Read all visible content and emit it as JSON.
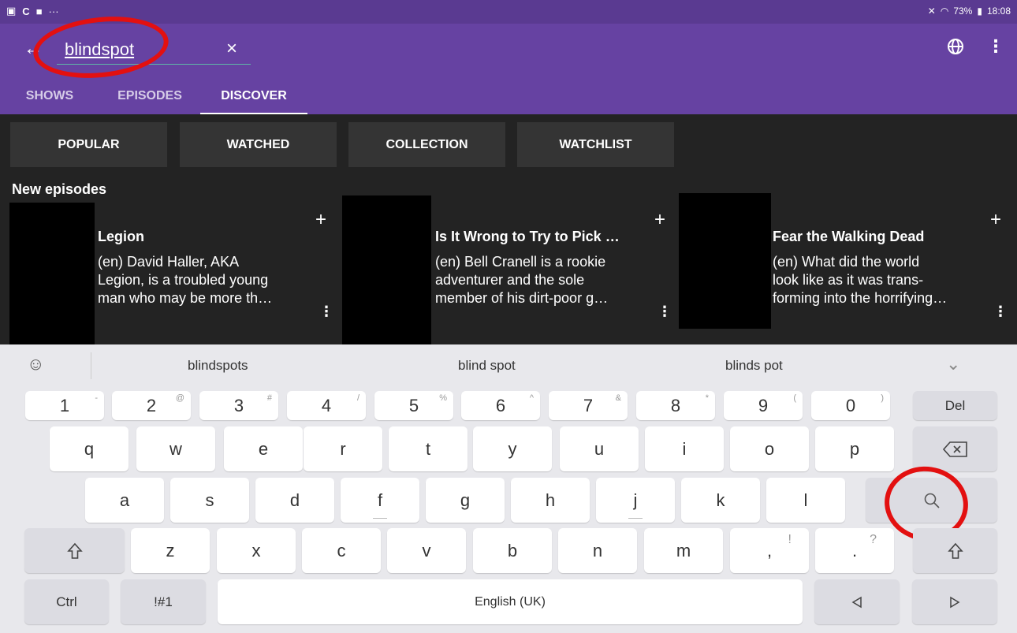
{
  "status": {
    "battery": "73%",
    "time": "18:08"
  },
  "search": {
    "query": "blindspot",
    "clear": "×"
  },
  "tabs": [
    "SHOWS",
    "EPISODES",
    "DISCOVER"
  ],
  "filters": [
    "POPULAR",
    "WATCHED",
    "COLLECTION",
    "WATCHLIST"
  ],
  "section_title": "New episodes",
  "cards": [
    {
      "title": "Legion",
      "desc": "(en) David Haller, AKA\nLegion, is a troubled young\nman who may be more th…"
    },
    {
      "title": "Is It Wrong to Try to Pick …",
      "desc": "(en) Bell Cranell is a rookie\nadventurer and the sole\nmember of his dirt-poor g…"
    },
    {
      "title": "Fear the Walking Dead",
      "desc": "(en) What did the world\nlook like as it was trans-\nforming into the horrifying…"
    }
  ],
  "keyboard": {
    "suggestions": [
      "blindspots",
      "blind spot",
      "blinds pot"
    ],
    "number_row": [
      {
        "k": "1",
        "s": "-"
      },
      {
        "k": "2",
        "s": "@"
      },
      {
        "k": "3",
        "s": "#"
      },
      {
        "k": "4",
        "s": "/"
      },
      {
        "k": "5",
        "s": "%"
      },
      {
        "k": "6",
        "s": "^"
      },
      {
        "k": "7",
        "s": "&"
      },
      {
        "k": "8",
        "s": "*"
      },
      {
        "k": "9",
        "s": "("
      },
      {
        "k": "0",
        "s": ")"
      }
    ],
    "del": "Del",
    "row1": [
      "q",
      "w",
      "e",
      "r",
      "t",
      "y",
      "u",
      "i",
      "o",
      "p"
    ],
    "row2": [
      "a",
      "s",
      "d",
      "f",
      "g",
      "h",
      "j",
      "k",
      "l"
    ],
    "row3": [
      "z",
      "x",
      "c",
      "v",
      "b",
      "n",
      "m"
    ],
    "comma": ",",
    "comma_sub": "!",
    "period": ".",
    "period_sub": "?",
    "ctrl": "Ctrl",
    "sym": "!#1",
    "space": "English (UK)"
  },
  "colors": {
    "appbar": "#6642a2",
    "statusbar": "#5a3a91",
    "annotation": "#e31010"
  }
}
